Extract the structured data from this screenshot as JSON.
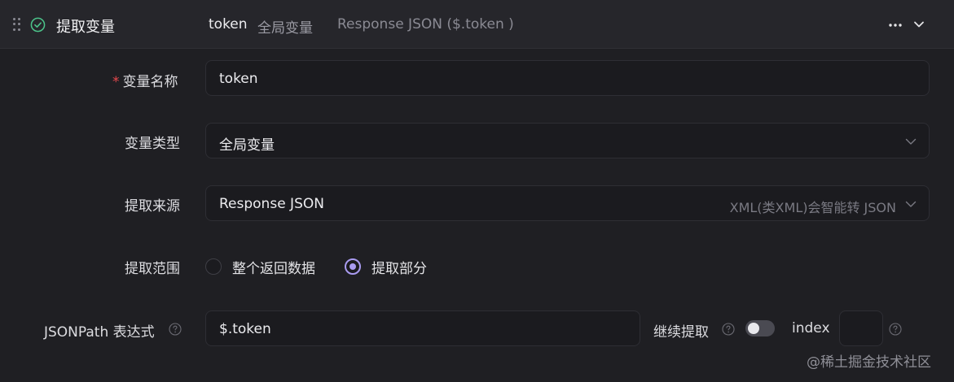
{
  "header": {
    "title": "提取变量",
    "summary_name": "token",
    "summary_type": "全局变量",
    "summary_source": "Response JSON ($.token )",
    "icons": [
      "drag-handle-icon",
      "check-circle-icon",
      "more-horizontal-icon",
      "chevron-down-icon"
    ]
  },
  "form": {
    "name_label": "变量名称",
    "required_mark": "*",
    "name_value": "token",
    "type_label": "变量类型",
    "type_value": "全局变量",
    "source_label": "提取来源",
    "source_value": "Response JSON",
    "source_hint": "XML(类XML)会智能转 JSON",
    "scope_label": "提取范围",
    "scope_options": [
      {
        "label": "整个返回数据",
        "selected": false
      },
      {
        "label": "提取部分",
        "selected": true
      }
    ],
    "jsonpath_label": "JSONPath 表达式",
    "jsonpath_value": "$.token",
    "continue_label": "继续提取",
    "continue_enabled": false,
    "index_label": "index",
    "index_value": ""
  },
  "watermark": "@稀土掘金技术社区",
  "colors": {
    "accent": "#a99bf0",
    "success": "#4cc38a",
    "required": "#e5484d"
  }
}
